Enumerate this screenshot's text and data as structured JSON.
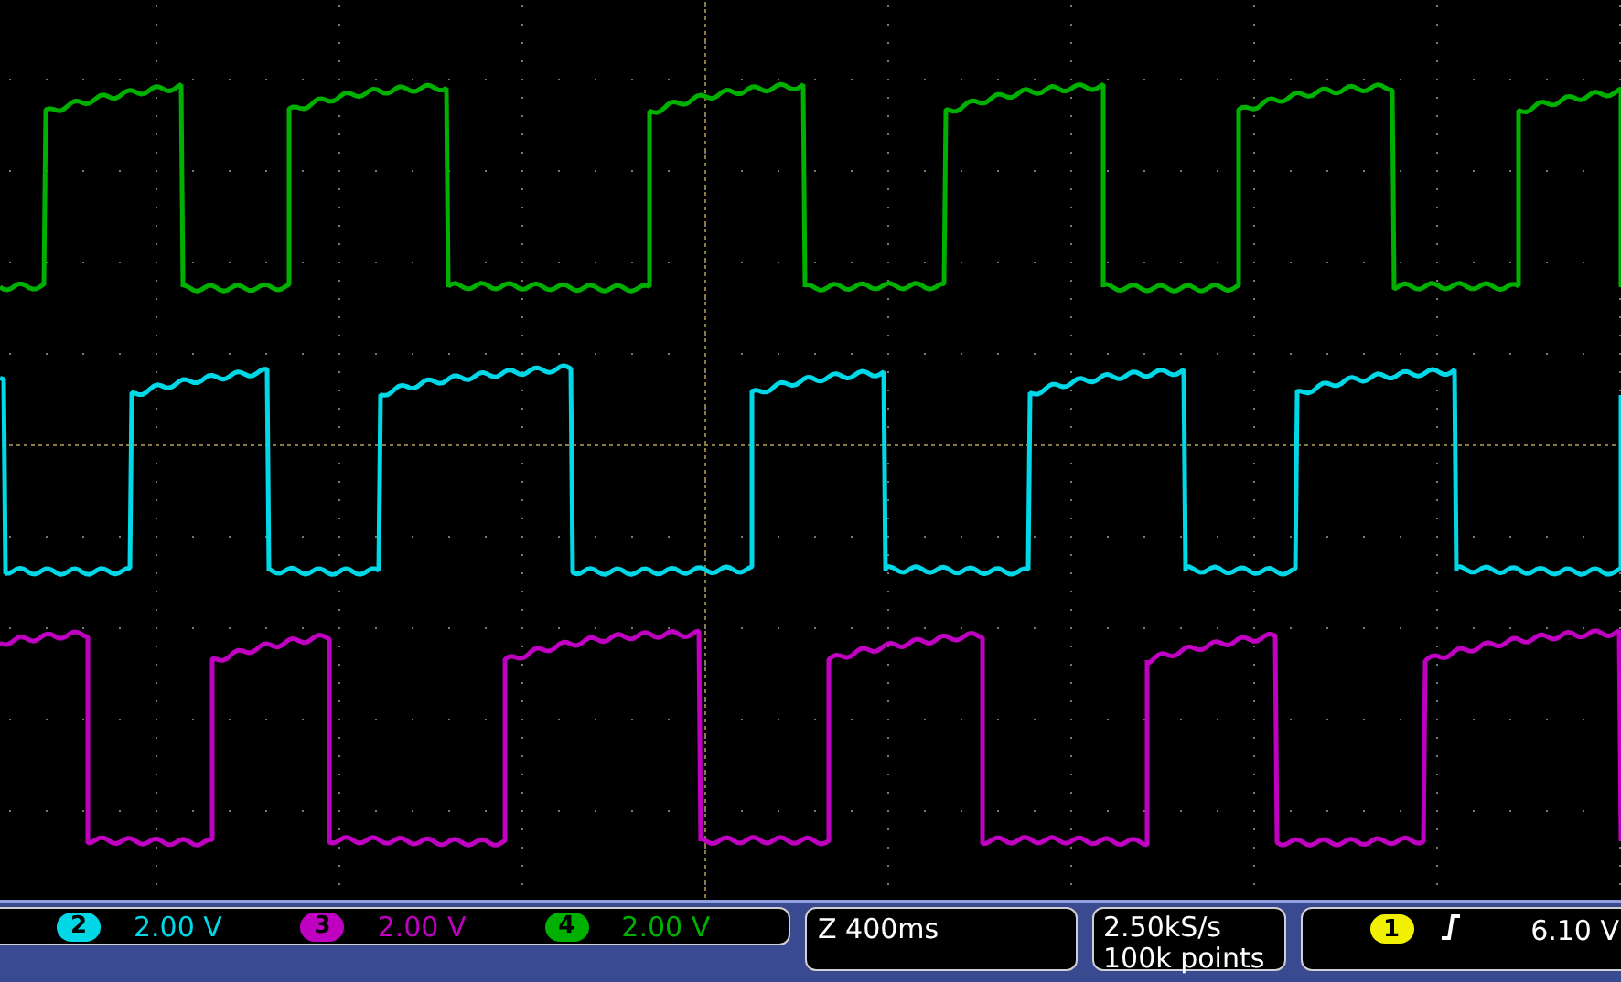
{
  "channels": [
    {
      "number": "2",
      "scale": "2.00 V",
      "color": "#00d8e8"
    },
    {
      "number": "3",
      "scale": "2.00 V",
      "color": "#c000c0"
    },
    {
      "number": "4",
      "scale": "2.00 V",
      "color": "#00b000"
    }
  ],
  "timebase": {
    "zoom": "Z 400ms"
  },
  "acquisition": {
    "sample_rate": "2.50kS/s",
    "record_length": "100k points"
  },
  "trigger": {
    "channel": "1",
    "color": "#f0f000",
    "level": "6.10 V"
  }
}
